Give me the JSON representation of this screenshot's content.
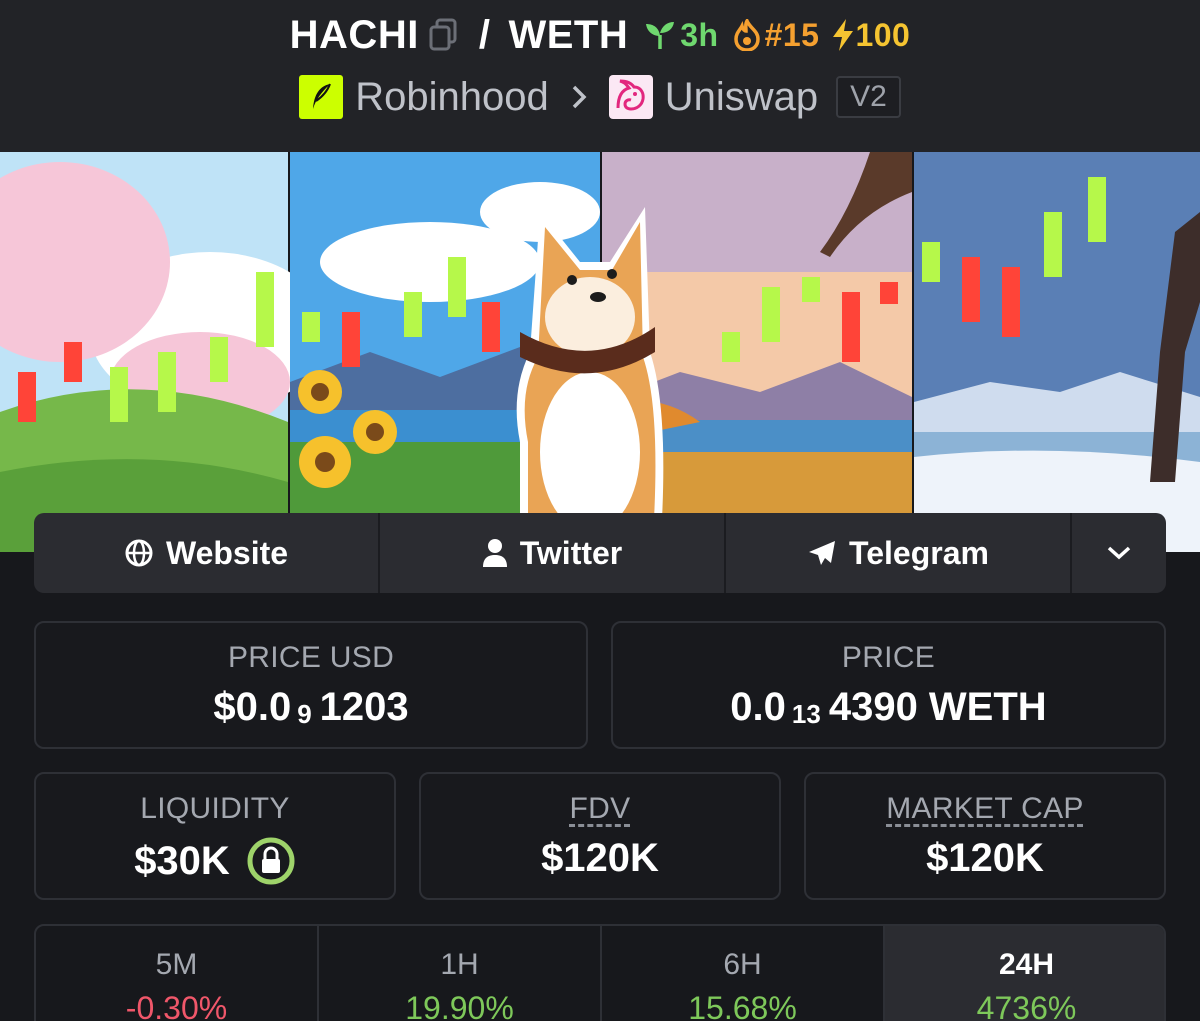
{
  "header": {
    "base_token": "HACHI",
    "separator": "/",
    "quote_token": "WETH",
    "age": "3h",
    "rank": "#15",
    "boost": "100",
    "chain": "Robinhood",
    "dex": "Uniswap",
    "version": "V2"
  },
  "links": {
    "website": "Website",
    "twitter": "Twitter",
    "telegram": "Telegram"
  },
  "stats": {
    "price_usd": {
      "label": "PRICE USD",
      "prefix": "$0.0",
      "sub": "9",
      "suffix": "1203"
    },
    "price": {
      "label": "PRICE",
      "prefix": "0.0",
      "sub": "13",
      "suffix": "4390 WETH"
    },
    "liquidity": {
      "label": "LIQUIDITY",
      "value": "$30K"
    },
    "fdv": {
      "label": "FDV",
      "value": "$120K"
    },
    "market_cap": {
      "label": "MARKET CAP",
      "value": "$120K"
    }
  },
  "timeframes": [
    {
      "label": "5M",
      "change": "-0.30%"
    },
    {
      "label": "1H",
      "change": "19.90%"
    },
    {
      "label": "6H",
      "change": "15.68%"
    },
    {
      "label": "24H",
      "change": "4736%"
    }
  ],
  "colors": {
    "background": "#17181c",
    "header_bg": "#222327",
    "positive": "#7ec85a",
    "negative": "#f0576a",
    "age_green": "#6fd86f",
    "rank_orange": "#f5a030",
    "boost_yellow": "#f5c431",
    "robinhood_green": "#ccff00",
    "uniswap_pink": "#e2277e"
  },
  "icons": {
    "copy": "copy-icon",
    "age": "seedling-icon",
    "rank": "flame-icon",
    "boost": "lightning-icon",
    "website": "globe-icon",
    "twitter": "user-icon",
    "telegram": "paper-plane-icon",
    "more": "chevron-down-icon",
    "liquidity_lock": "lock-icon"
  }
}
